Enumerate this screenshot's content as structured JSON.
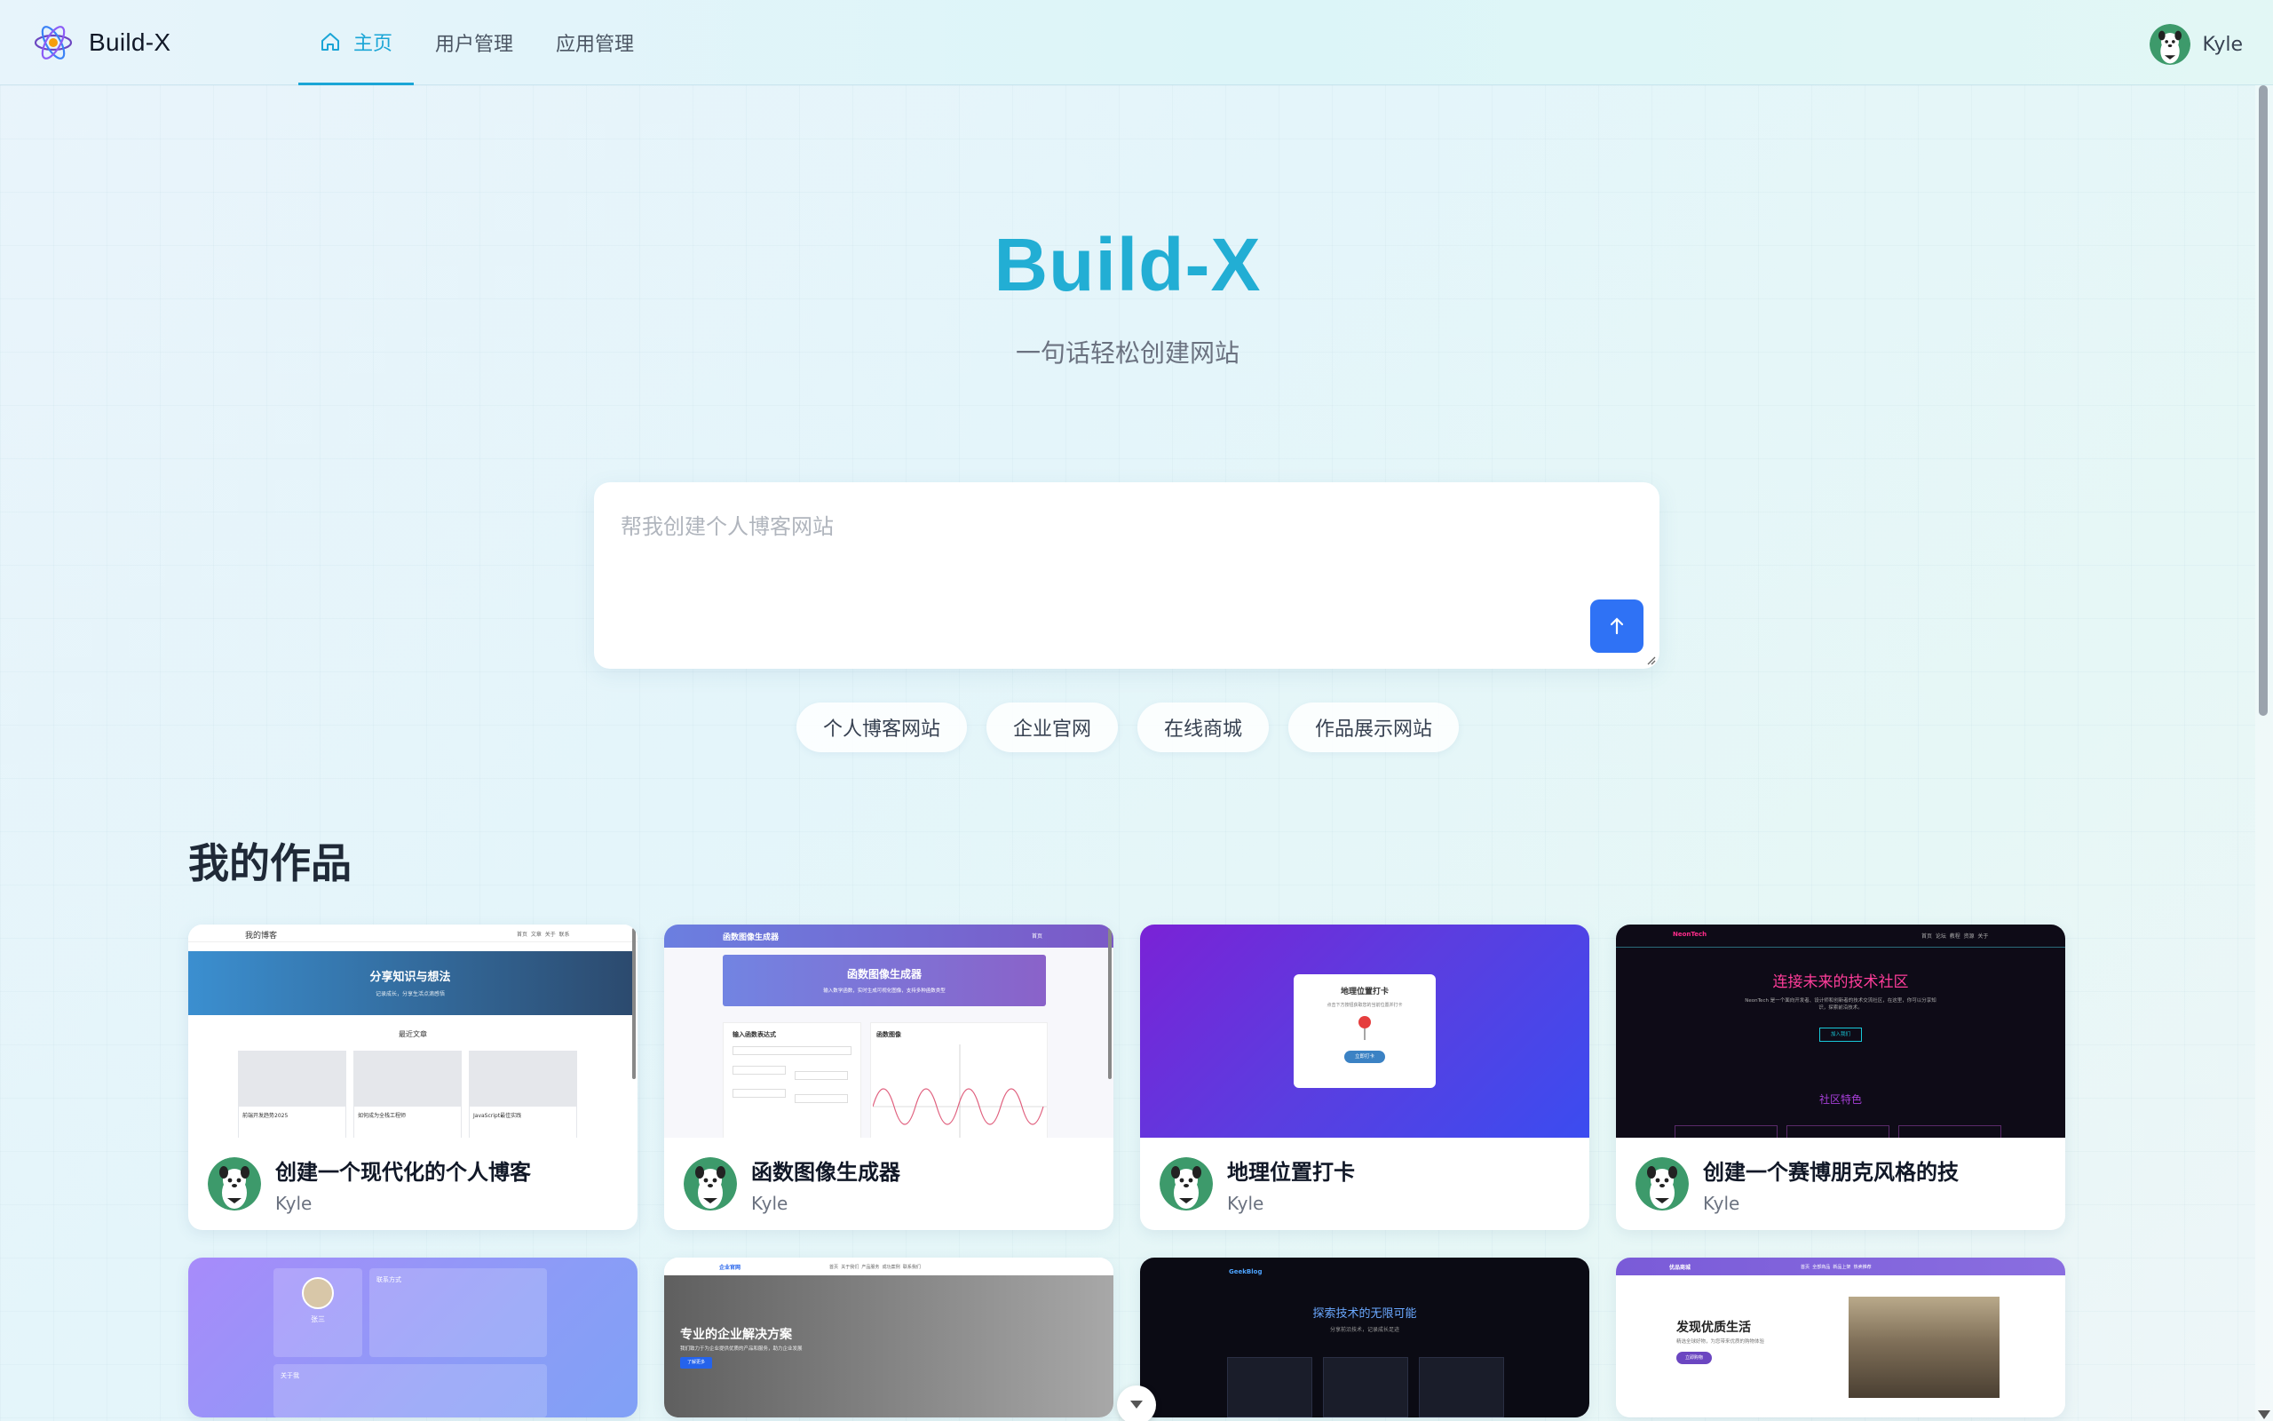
{
  "app": {
    "name": "Build-X"
  },
  "nav": {
    "items": [
      {
        "label": "主页"
      },
      {
        "label": "用户管理"
      },
      {
        "label": "应用管理"
      }
    ]
  },
  "user": {
    "name": "Kyle"
  },
  "hero": {
    "title": "Build-X",
    "subtitle": "一句话轻松创建网站"
  },
  "prompt": {
    "placeholder": "帮我创建个人博客网站",
    "send_icon": "arrow-up-icon"
  },
  "chips": [
    {
      "label": "个人博客网站"
    },
    {
      "label": "企业官网"
    },
    {
      "label": "在线商城"
    },
    {
      "label": "作品展示网站"
    }
  ],
  "works": {
    "title": "我的作品",
    "items": [
      {
        "title": "创建一个现代化的个人博客",
        "author": "Kyle",
        "thumb": {
          "header": "我的博客",
          "nav": [
            "首页",
            "文章",
            "关于",
            "联系"
          ],
          "banner_title": "分享知识与想法",
          "banner_sub": "记录成长，分享生活点滴感悟",
          "section": "最近文章",
          "posts": [
            "前端开发趋势2025",
            "如何成为全栈工程师",
            "JavaScript最佳实践"
          ]
        }
      },
      {
        "title": "函数图像生成器",
        "author": "Kyle",
        "thumb": {
          "header": "函数图像生成器",
          "nav": "首页",
          "banner_title": "函数图像生成器",
          "banner_sub": "输入数学函数，实时生成可视化图像，支持多种函数类型",
          "input_title": "输入函数表达式",
          "chart_title": "函数图像"
        }
      },
      {
        "title": "地理位置打卡",
        "author": "Kyle",
        "thumb": {
          "title": "地理位置打卡",
          "sub": "点击下方按钮获取您的当前位置并打卡",
          "button": "立即打卡"
        }
      },
      {
        "title": "创建一个赛博朋克风格的技",
        "author": "Kyle",
        "thumb": {
          "logo": "NeonTech",
          "nav": [
            "首页",
            "论坛",
            "教程",
            "资源",
            "关于"
          ],
          "banner_title": "连接未来的技术社区",
          "banner_sub": "NeonTech 是一个面向开发者、设计师和创新者的技术交流社区，在这里，你可以分享知识，探索前沿技术。",
          "button": "加入我们",
          "section": "社区特色"
        }
      },
      {
        "title": "",
        "author": "",
        "thumb": {
          "name": "张三",
          "contact_title": "联系方式",
          "about_title": "关于我"
        }
      },
      {
        "title": "",
        "author": "",
        "thumb": {
          "logo": "企业官网",
          "nav": [
            "首页",
            "关于我们",
            "产品服务",
            "成功案例",
            "联系我们"
          ],
          "banner_title": "专业的企业解决方案",
          "banner_sub": "我们致力于为企业提供优质的产品和服务，助力企业发展",
          "button": "了解更多"
        }
      },
      {
        "title": "",
        "author": "",
        "thumb": {
          "logo": "GeekBlog",
          "banner_title": "探索技术的无限可能",
          "banner_sub": "分享前沿技术，记录成长足迹"
        }
      },
      {
        "title": "",
        "author": "",
        "thumb": {
          "logo": "优品商城",
          "nav": [
            "首页",
            "全部商品",
            "新品上架",
            "热卖推荐"
          ],
          "banner_title": "发现优质生活",
          "banner_sub": "精选全球好物，为您带来优质的购物体验",
          "button": "立即购物"
        }
      }
    ]
  }
}
